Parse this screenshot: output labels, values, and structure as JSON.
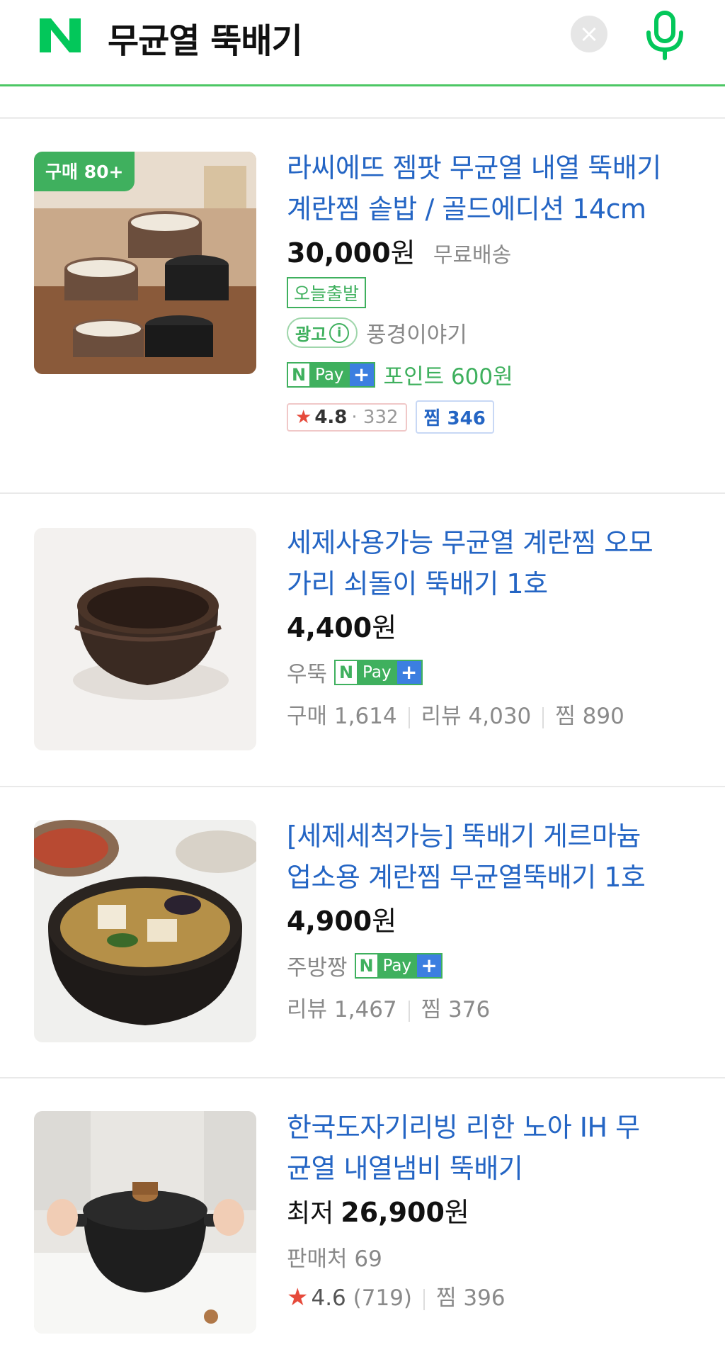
{
  "search": {
    "query": "무균열 뚝배기",
    "clear_icon": "close-icon",
    "mic_icon": "microphone-icon",
    "logo_text": "N",
    "brand_color": "#03c75a"
  },
  "products": [
    {
      "badge": "구매 80+",
      "title_line1": "라씨에뜨 젬팟 무균열 내열 뚝배기",
      "title_line2": "계란찜 솥밥 / 골드에디션 14cm",
      "price": "30,000",
      "currency": "원",
      "shipping": "무료배송",
      "today": "오늘출발",
      "ad_label": "광고",
      "seller": "풍경이야기",
      "npay_label": "Pay",
      "point": "포인트 600원",
      "rating": "4.8",
      "rating_count": "332",
      "jjim": "찜 346"
    },
    {
      "title_line1": "세제사용가능 무균열 계란찜 오모",
      "title_line2": "가리 쇠돌이 뚝배기 1호",
      "price": "4,400",
      "currency": "원",
      "seller": "우뚝",
      "npay_label": "Pay",
      "stat1": "구매 1,614",
      "stat2": "리뷰 4,030",
      "stat3": "찜 890"
    },
    {
      "title_line1": "[세제세척가능] 뚝배기 게르마늄",
      "title_line2": "업소용 계란찜 무균열뚝배기 1호",
      "price": "4,900",
      "currency": "원",
      "seller": "주방짱",
      "npay_label": "Pay",
      "stat1": "리뷰 1,467",
      "stat2": "찜 376"
    },
    {
      "title_line1": "한국도자기리빙 리한 노아 IH 무",
      "title_line2": "균열 내열냄비 뚝배기",
      "price_prefix": "최저",
      "price": "26,900",
      "currency": "원",
      "sellers": "판매처 69",
      "rating": "4.6",
      "rating_count": "(719)",
      "jjim": "찜 396"
    }
  ]
}
